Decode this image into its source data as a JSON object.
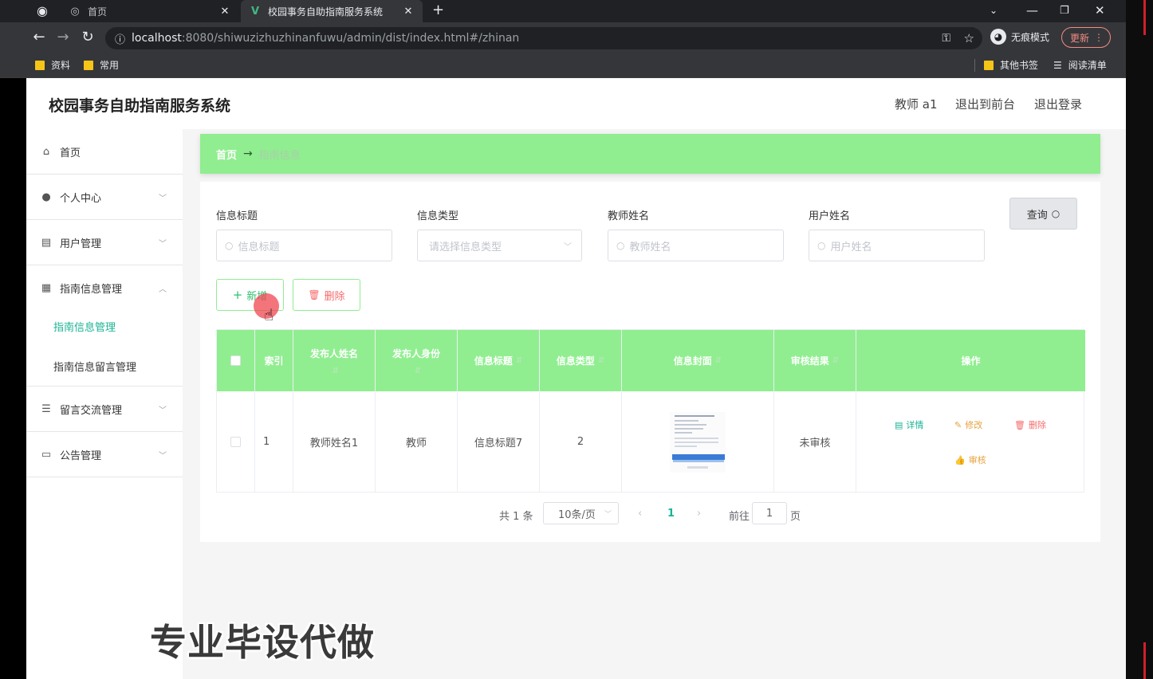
{
  "browser": {
    "tabs": [
      {
        "title": "首页",
        "active": false
      },
      {
        "title": "校园事务自助指南服务系统",
        "active": true
      }
    ],
    "new_tab": "+",
    "url": {
      "host": "localhost",
      "rest": ":8080/shiwuzizhuzhinanfuwu/admin/dist/index.html#/zhinan"
    },
    "profile_label": "无痕模式",
    "update_label": "更新",
    "bookmarks": [
      {
        "label": "资料"
      },
      {
        "label": "常用"
      }
    ],
    "other_bookmarks": "其他书签",
    "reading_list": "阅读清单"
  },
  "header": {
    "site_title": "校园事务自助指南服务系统",
    "user": "教师 a1",
    "back_to_front": "退出到前台",
    "logout": "退出登录"
  },
  "sidebar": {
    "items": [
      {
        "label": "首页",
        "icon": "home-icon"
      },
      {
        "label": "个人中心",
        "icon": "user-icon"
      },
      {
        "label": "用户管理",
        "icon": "users-icon"
      },
      {
        "label": "指南信息管理",
        "icon": "grid-icon"
      },
      {
        "label": "留言交流管理",
        "icon": "sliders-icon"
      },
      {
        "label": "公告管理",
        "icon": "notice-icon"
      }
    ],
    "subitems": [
      {
        "label": "指南信息管理",
        "active": true
      },
      {
        "label": "指南信息留言管理",
        "active": false
      }
    ]
  },
  "breadcrumb": {
    "home": "首页",
    "arrow": "→",
    "current": "指南信息"
  },
  "filters": {
    "title_label": "信息标题",
    "title_placeholder": "信息标题",
    "type_label": "信息类型",
    "type_placeholder": "请选择信息类型",
    "teacher_label": "教师姓名",
    "teacher_placeholder": "教师姓名",
    "user_label": "用户姓名",
    "user_placeholder": "用户姓名",
    "query_button": "查询"
  },
  "actions": {
    "add": "新增",
    "delete": "删除"
  },
  "table": {
    "headers": {
      "index": "索引",
      "publisher_name": "发布人姓名",
      "publisher_role": "发布人身份",
      "info_title": "信息标题",
      "info_type": "信息类型",
      "info_cover": "信息封面",
      "review_result": "审核结果",
      "operation": "操作"
    },
    "rows": [
      {
        "index": "1",
        "publisher_name": "教师姓名1",
        "publisher_role": "教师",
        "info_title": "信息标题7",
        "info_type": "2",
        "review_result": "未审核",
        "ops": {
          "detail": "详情",
          "edit": "修改",
          "delete": "删除",
          "review": "审核"
        }
      }
    ]
  },
  "pagination": {
    "total": "共 1 条",
    "page_size": "10条/页",
    "current_page": "1",
    "goto_label": "前往",
    "goto_value": "1",
    "page_suffix": "页"
  },
  "watermark": "专业毕设代做",
  "colors": {
    "accent_green": "#90ee90",
    "active_text": "#1ab394",
    "danger": "#f56c6c",
    "warning": "#e6a23c"
  }
}
